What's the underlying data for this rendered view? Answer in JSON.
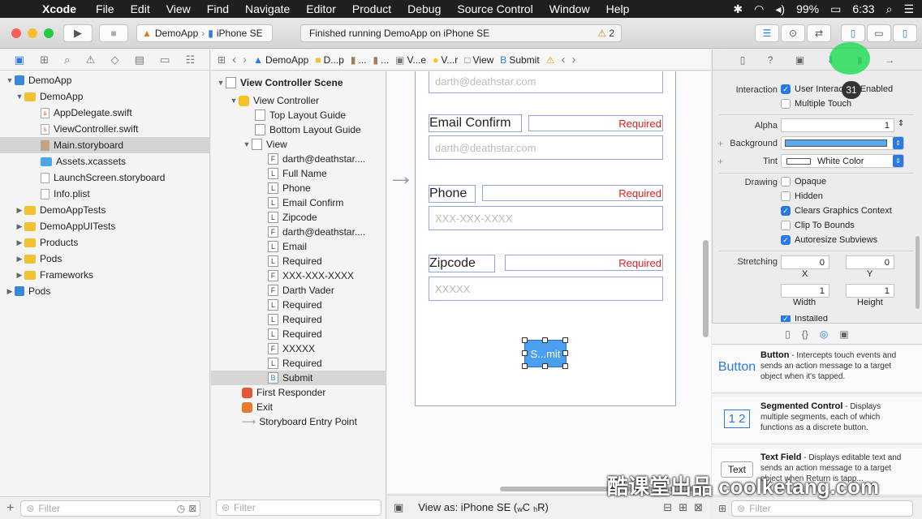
{
  "menubar": {
    "app": "Xcode",
    "items": [
      "File",
      "Edit",
      "View",
      "Find",
      "Navigate",
      "Editor",
      "Product",
      "Debug",
      "Source Control",
      "Window",
      "Help"
    ],
    "battery": "99%",
    "time": "6:33"
  },
  "toolbar": {
    "scheme_target": "DemoApp",
    "scheme_device": "iPhone SE",
    "activity": "Finished running DemoApp on iPhone SE",
    "warning_count": "2"
  },
  "navigator": {
    "rows": [
      {
        "label": "DemoApp",
        "kind": "project"
      },
      {
        "label": "DemoApp",
        "kind": "folder"
      },
      {
        "label": "AppDelegate.swift",
        "kind": "file"
      },
      {
        "label": "ViewController.swift",
        "kind": "file"
      },
      {
        "label": "Main.storyboard",
        "kind": "file"
      },
      {
        "label": "Assets.xcassets",
        "kind": "folder"
      },
      {
        "label": "LaunchScreen.storyboard",
        "kind": "file"
      },
      {
        "label": "Info.plist",
        "kind": "file"
      },
      {
        "label": "DemoAppTests",
        "kind": "folder"
      },
      {
        "label": "DemoAppUITests",
        "kind": "folder"
      },
      {
        "label": "Products",
        "kind": "folder"
      },
      {
        "label": "Pods",
        "kind": "folder"
      },
      {
        "label": "Frameworks",
        "kind": "folder"
      },
      {
        "label": "Pods",
        "kind": "project"
      }
    ],
    "filter_placeholder": "Filter"
  },
  "jumpbar": {
    "crumbs": [
      "DemoApp",
      "D...p",
      "...",
      "...",
      "V...e",
      "V...r",
      "View",
      "Submit"
    ]
  },
  "outline": {
    "scene": "View Controller Scene",
    "controller": "View Controller",
    "guides": [
      "Top Layout Guide",
      "Bottom Layout Guide"
    ],
    "view": "View",
    "children": [
      {
        "badge": "F",
        "label": "darth@deathstar...."
      },
      {
        "badge": "L",
        "label": "Full Name"
      },
      {
        "badge": "L",
        "label": "Phone"
      },
      {
        "badge": "L",
        "label": "Email Confirm"
      },
      {
        "badge": "L",
        "label": "Zipcode"
      },
      {
        "badge": "F",
        "label": "darth@deathstar...."
      },
      {
        "badge": "L",
        "label": "Email"
      },
      {
        "badge": "L",
        "label": "Required"
      },
      {
        "badge": "F",
        "label": "XXX-XXX-XXXX"
      },
      {
        "badge": "F",
        "label": "Darth Vader"
      },
      {
        "badge": "L",
        "label": "Required"
      },
      {
        "badge": "L",
        "label": "Required"
      },
      {
        "badge": "L",
        "label": "Required"
      },
      {
        "badge": "F",
        "label": "XXXXX"
      },
      {
        "badge": "L",
        "label": "Required"
      },
      {
        "badge": "B",
        "label": "Submit"
      }
    ],
    "first_responder": "First Responder",
    "exit": "Exit",
    "entry_point": "Storyboard Entry Point",
    "filter_placeholder": "Filter"
  },
  "canvas": {
    "email_placeholder": "darth@deathstar.com",
    "email_confirm_label": "Email Confirm",
    "email_confirm_placeholder": "darth@deathstar.com",
    "phone_label": "Phone",
    "phone_placeholder": "XXX-XXX-XXXX",
    "zipcode_label": "Zipcode",
    "zipcode_placeholder": "XXXXX",
    "required": "Required",
    "submit": "S...mit"
  },
  "bottombar": {
    "view_as": "View as: iPhone SE (",
    "size_w": "w",
    "size_c": "C",
    "size_h": "h",
    "size_r": "R)"
  },
  "inspector": {
    "interaction_label": "Interaction",
    "user_interaction": "User Interaction Enabled",
    "multiple_touch": "Multiple Touch",
    "alpha_label": "Alpha",
    "alpha_value": "1",
    "background_label": "Background",
    "tint_label": "Tint",
    "tint_value": "White Color",
    "drawing_label": "Drawing",
    "drawing": [
      {
        "label": "Opaque",
        "checked": false
      },
      {
        "label": "Hidden",
        "checked": false
      },
      {
        "label": "Clears Graphics Context",
        "checked": true
      },
      {
        "label": "Clip To Bounds",
        "checked": false
      },
      {
        "label": "Autoresize Subviews",
        "checked": true
      }
    ],
    "stretching_label": "Stretching",
    "stretch_x": "0",
    "stretch_y": "0",
    "stretch_w": "1",
    "stretch_h": "1",
    "x_label": "X",
    "y_label": "Y",
    "width_label": "Width",
    "height_label": "Height",
    "installed": "Installed",
    "background_color": "#5aa9ef"
  },
  "library": {
    "filter_placeholder": "Filter",
    "items": [
      {
        "thumb": "Button",
        "title": "Button",
        "desc": " - Intercepts touch events and sends an action message to a target object when it's tapped."
      },
      {
        "thumb": "1 2",
        "title": "Segmented Control",
        "desc": " - Displays multiple segments, each of which functions as a discrete button."
      },
      {
        "thumb": "Text",
        "title": "Text Field",
        "desc": " - Displays editable text and sends an action message to a target object when Return is tapp..."
      }
    ]
  },
  "overlay": {
    "click_count": "31",
    "watermark": "酷课堂出品 coolketang.com"
  }
}
